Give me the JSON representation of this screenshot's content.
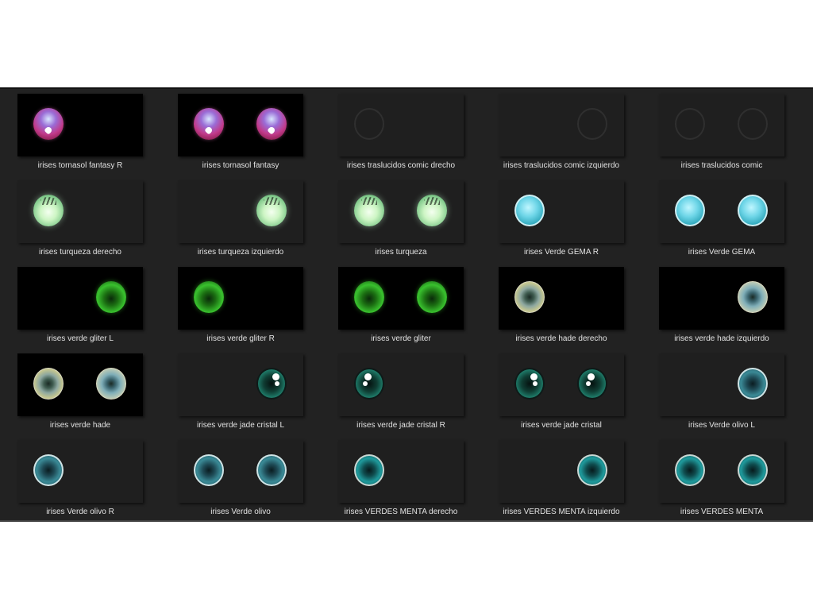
{
  "items": [
    {
      "label": "irises tornasol fantasy R"
    },
    {
      "label": "irises tornasol fantasy"
    },
    {
      "label": "irises traslucidos comic drecho"
    },
    {
      "label": "irises traslucidos comic izquierdo"
    },
    {
      "label": "irises traslucidos comic"
    },
    {
      "label": "irises turqueza derecho"
    },
    {
      "label": "irises turqueza izquierdo"
    },
    {
      "label": "irises turqueza"
    },
    {
      "label": "irises Verde GEMA R"
    },
    {
      "label": "irises Verde GEMA"
    },
    {
      "label": "irises verde gliter L"
    },
    {
      "label": "irises verde gliter R"
    },
    {
      "label": "irises verde gliter"
    },
    {
      "label": "irises verde hade derecho"
    },
    {
      "label": "irises verde hade izquierdo"
    },
    {
      "label": "irises verde hade"
    },
    {
      "label": "irises verde jade cristal L"
    },
    {
      "label": "irises verde jade cristal R"
    },
    {
      "label": "irises verde jade cristal"
    },
    {
      "label": "irises Verde olivo L"
    },
    {
      "label": "irises Verde olivo R"
    },
    {
      "label": "irises Verde olivo"
    },
    {
      "label": "irises VERDES MENTA derecho"
    },
    {
      "label": "irises VERDES MENTA izquierdo"
    },
    {
      "label": "irises VERDES MENTA"
    }
  ]
}
